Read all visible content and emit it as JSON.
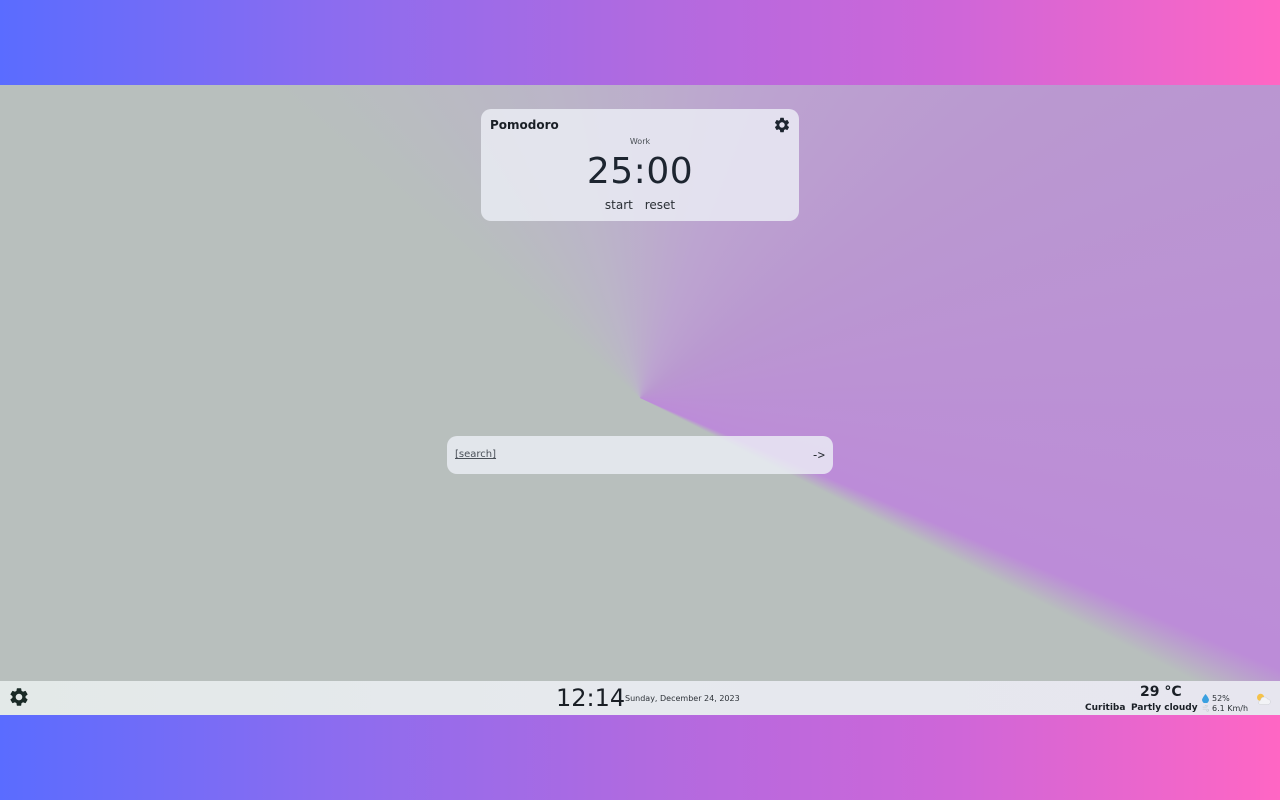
{
  "pomodoro": {
    "title": "Pomodoro",
    "mode": "Work",
    "time": "25:00",
    "start_label": "start",
    "reset_label": "reset",
    "settings_icon": "gear-icon"
  },
  "search": {
    "value": "",
    "hint": "[search]",
    "go_label": "->"
  },
  "taskbar": {
    "settings_icon": "gear-icon",
    "clock": "12:14",
    "date": "Sunday, December 24, 2023",
    "weather": {
      "temperature": "29 °C",
      "city": "Curitiba",
      "condition": "Partly cloudy",
      "humidity": "52%",
      "wind": "6.1 Km/h",
      "humidity_icon": "droplet-icon",
      "wind_icon": "wind-icon",
      "condition_icon": "partly-cloudy-icon"
    }
  },
  "colors": {
    "accent_humidity": "#3aa0e0",
    "text_dark": "#1a1f26"
  }
}
